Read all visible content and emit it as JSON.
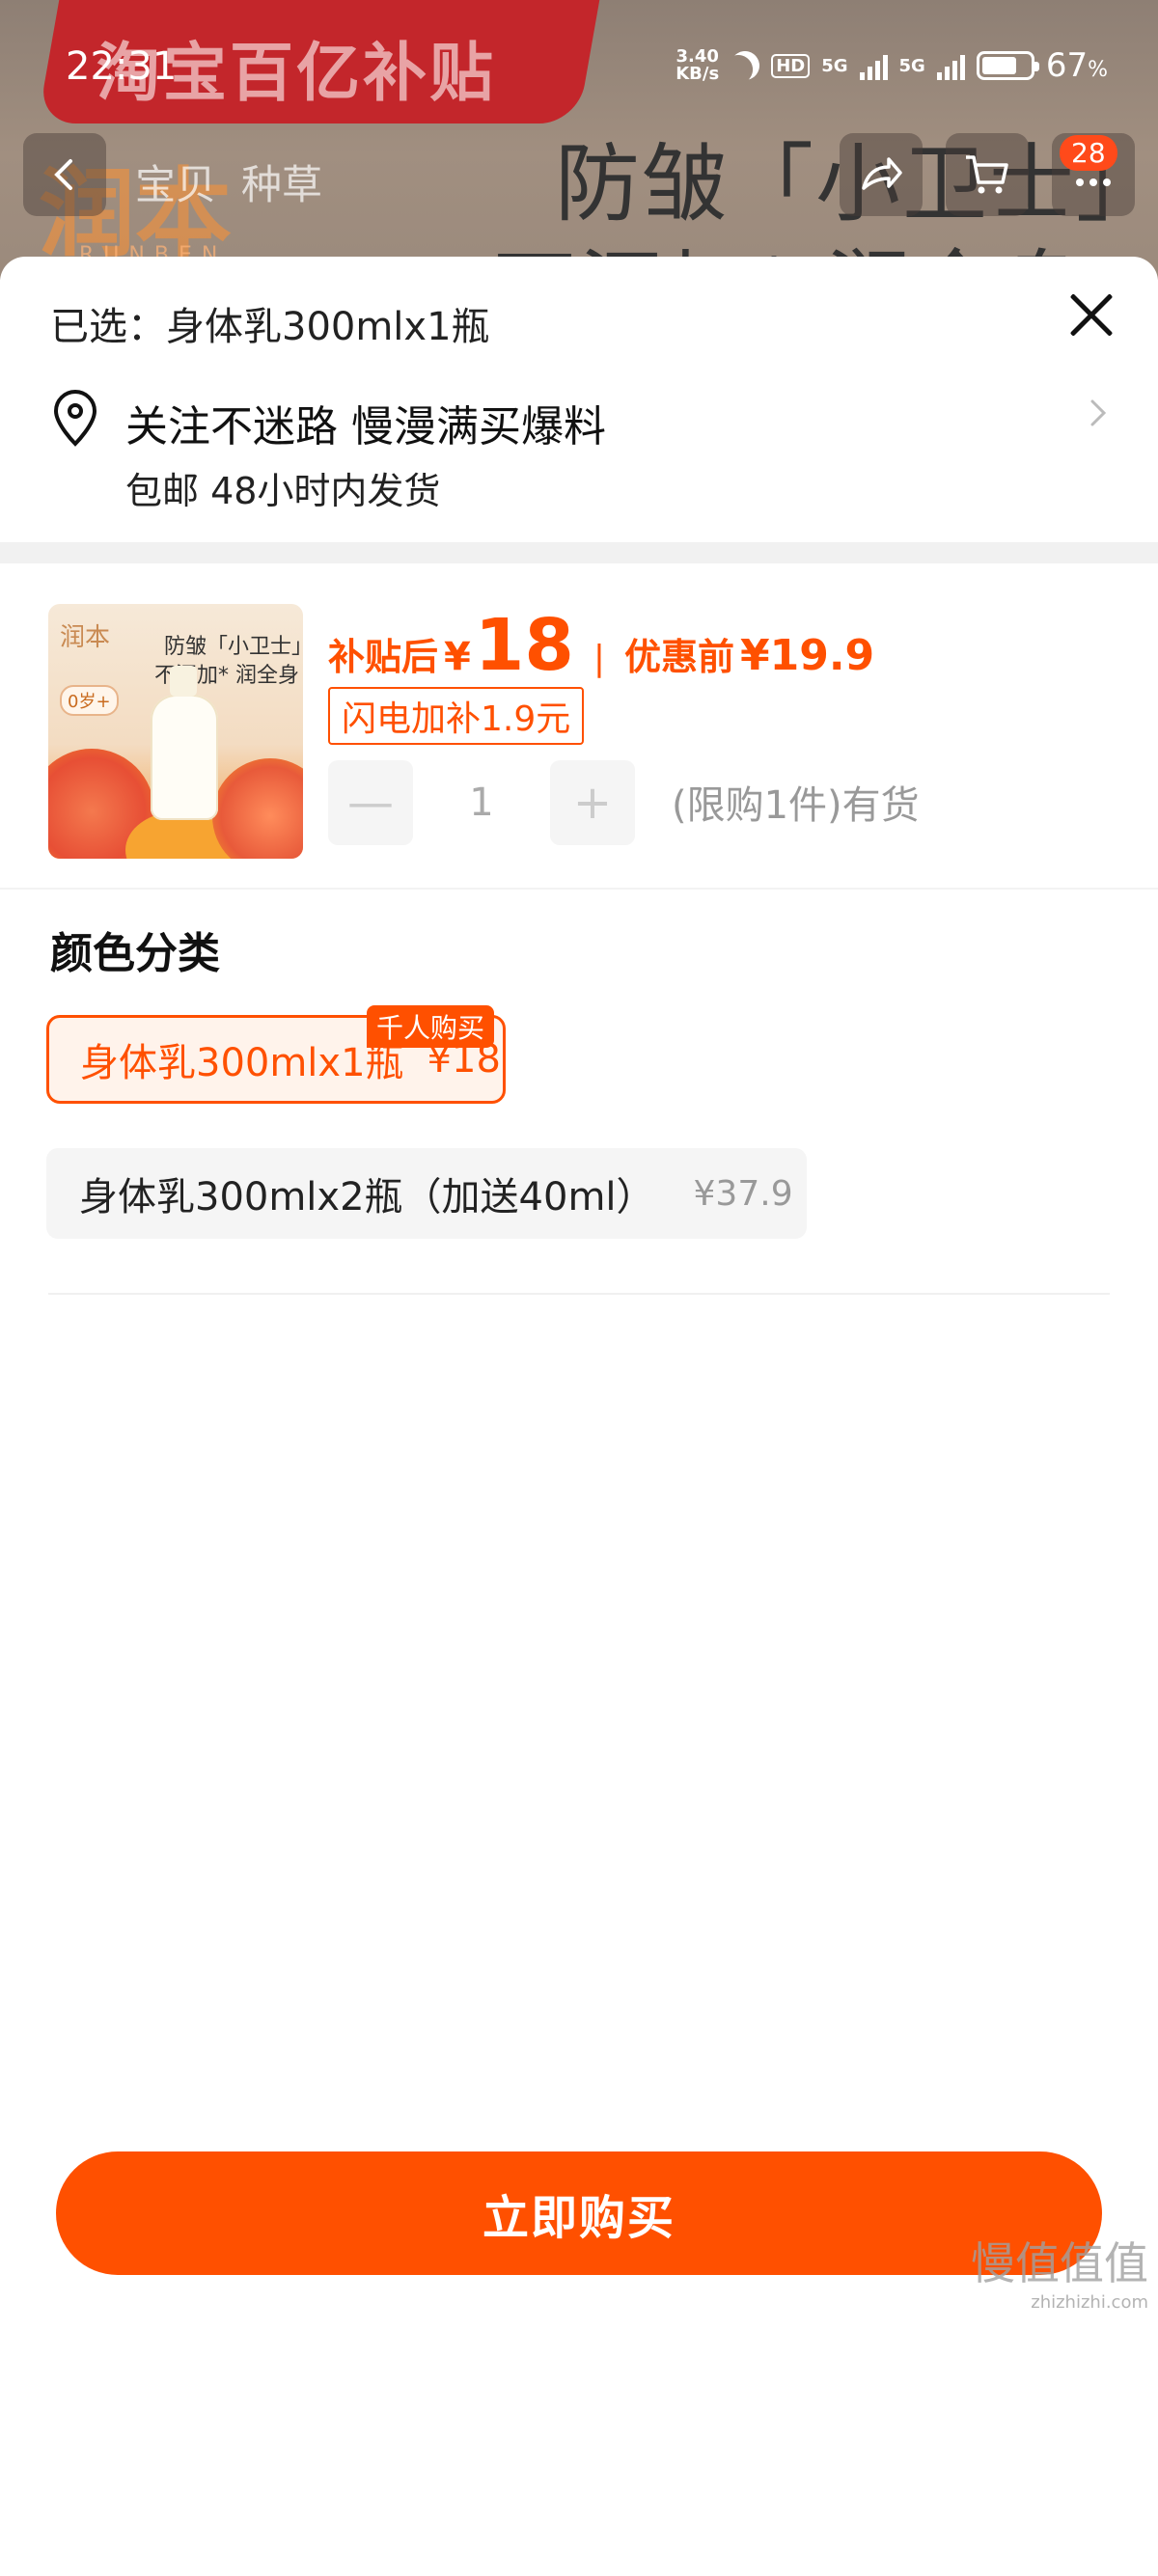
{
  "status_bar": {
    "time": "22:31",
    "net_speed": "3.40",
    "net_unit": "KB/s",
    "hd": "HD",
    "sig1": "5G",
    "sig2": "5G",
    "battery_pct": "67",
    "battery_unit": "%"
  },
  "background": {
    "banner_text": "淘宝百亿补贴",
    "brand_logo": "润本",
    "brand_sub": "RUNBEN",
    "hero_line1": "防皱「小卫士」",
    "hero_line2": "不添加* 润全身",
    "tab1": "宝贝",
    "tab2": "种草",
    "cart_count": "28"
  },
  "sheet": {
    "selected": "已选：身体乳300mlx1瓶",
    "address": "关注不迷路 慢漫满买爆料",
    "shipping": "包邮 48小时内发货"
  },
  "product": {
    "thumb_logo": "润本",
    "thumb_slogan1": "防皱「小卫士」",
    "thumb_slogan2": "不添加* 润全身",
    "thumb_age": "0岁+",
    "price_label": "补贴后",
    "yen": "¥",
    "price": "18",
    "sep": "|",
    "orig_label": "优惠前",
    "orig_price": "¥19.9",
    "flash_tag": "闪电加补1.9元",
    "minus": "—",
    "qty": "1",
    "plus": "+",
    "stock": "(限购1件)有货"
  },
  "options": {
    "title": "颜色分类",
    "hot_tag": "千人购买",
    "items": [
      {
        "label": "身体乳300mlx1瓶",
        "price": "¥18",
        "selected": true
      },
      {
        "label": "身体乳300mlx2瓶（加送40ml）",
        "price": "¥37.9",
        "selected": false
      }
    ]
  },
  "buy_button": "立即购买",
  "watermark": {
    "main": "慢值值值",
    "url": "zhizhizhi.com"
  },
  "colors": {
    "accent": "#ff5000",
    "banner": "#c3262b"
  }
}
